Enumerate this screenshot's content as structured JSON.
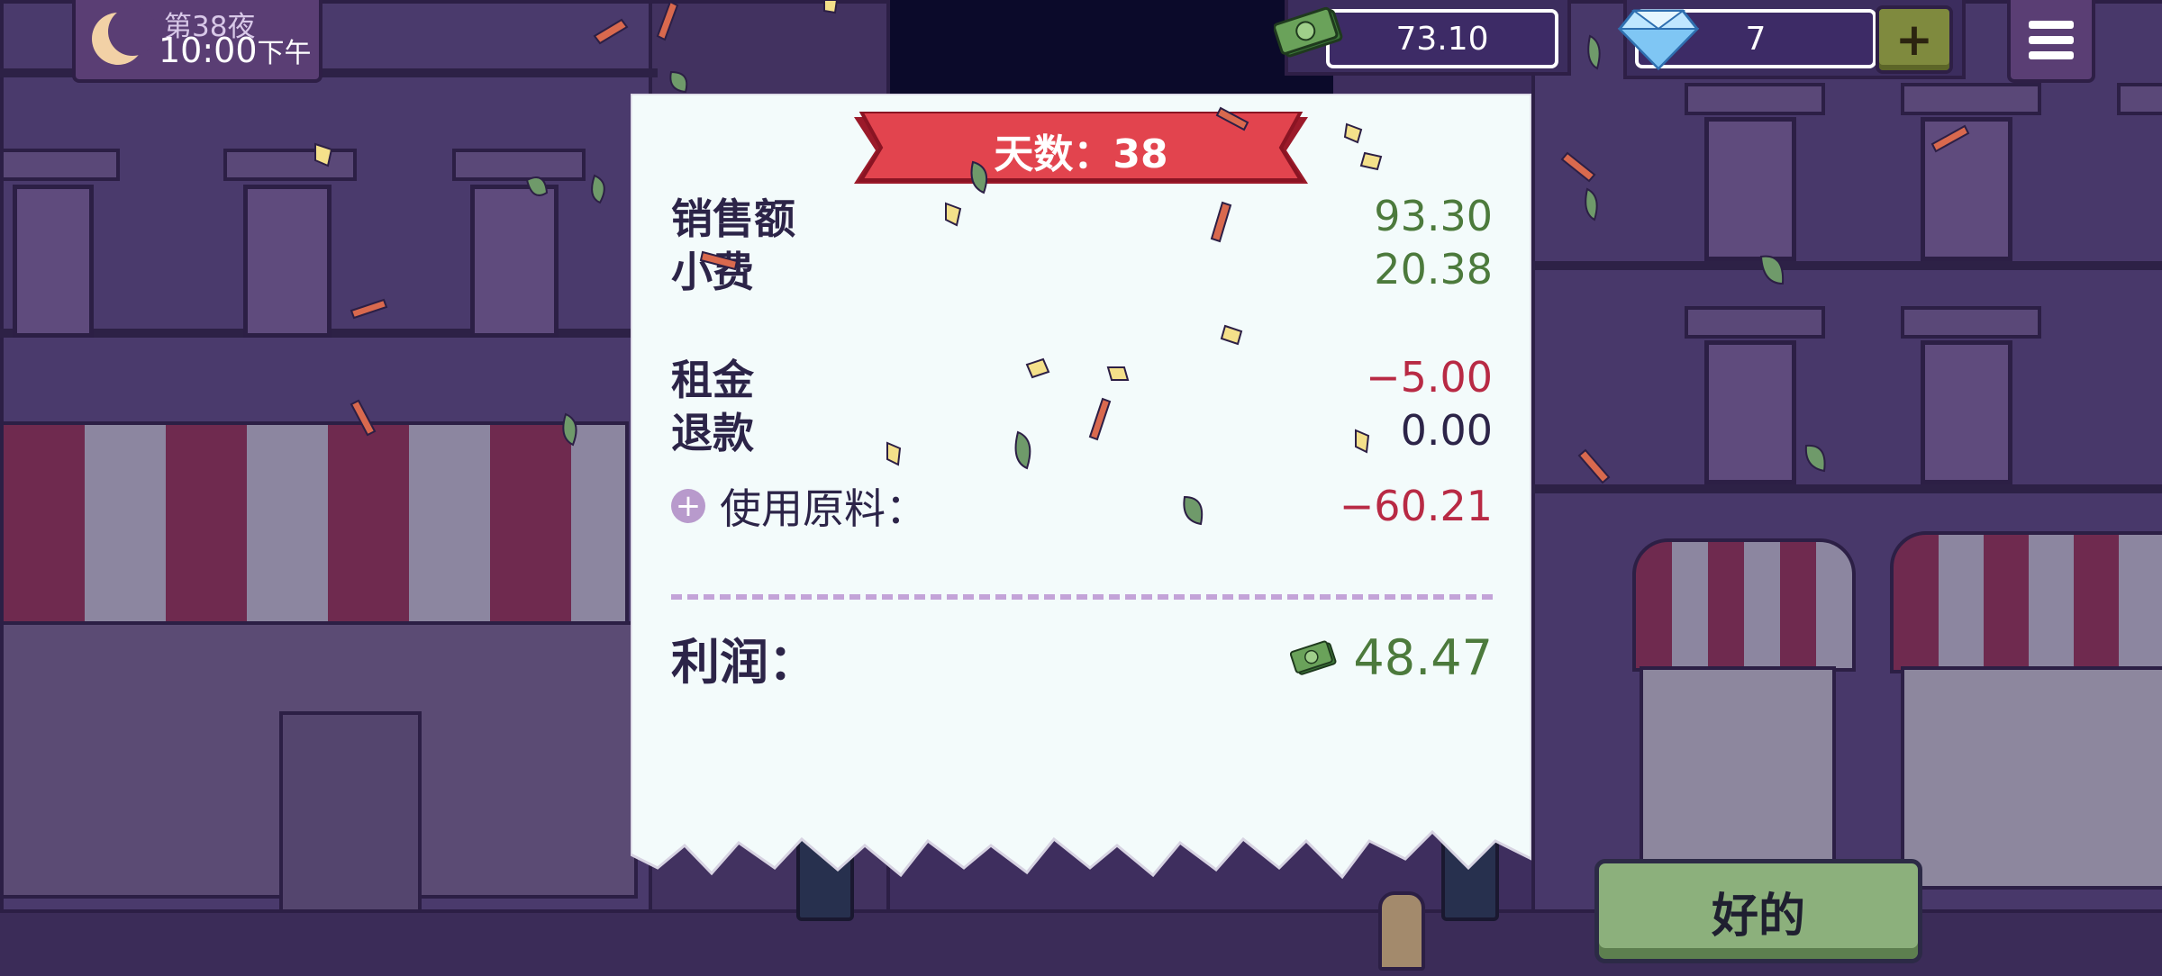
{
  "hud": {
    "night_label": "第38夜",
    "time": "10:00",
    "time_suffix": "下午",
    "cash": "73.10",
    "gems": "7",
    "add_label": "+"
  },
  "receipt": {
    "banner": "天数：38",
    "rows": [
      {
        "label": "销售额",
        "value": "93.30"
      },
      {
        "label": "小费",
        "value": "20.38"
      },
      {
        "label": "租金",
        "value": "−5.00"
      },
      {
        "label": "退款",
        "value": "0.00"
      },
      {
        "label": "使用原料：",
        "value": "−60.21"
      }
    ],
    "profit_label": "利润：",
    "profit_value": "48.47"
  },
  "ok_button": "好的",
  "colors": {
    "positive": "#4c7a3c",
    "negative": "#b82a44",
    "banner_red": "#e2444e",
    "button_green": "#8cb07c"
  },
  "icons": [
    "moon-icon",
    "cash-icon",
    "diamond-icon",
    "plus-icon",
    "menu-icon",
    "cash-small-icon",
    "plus-circle-icon"
  ]
}
